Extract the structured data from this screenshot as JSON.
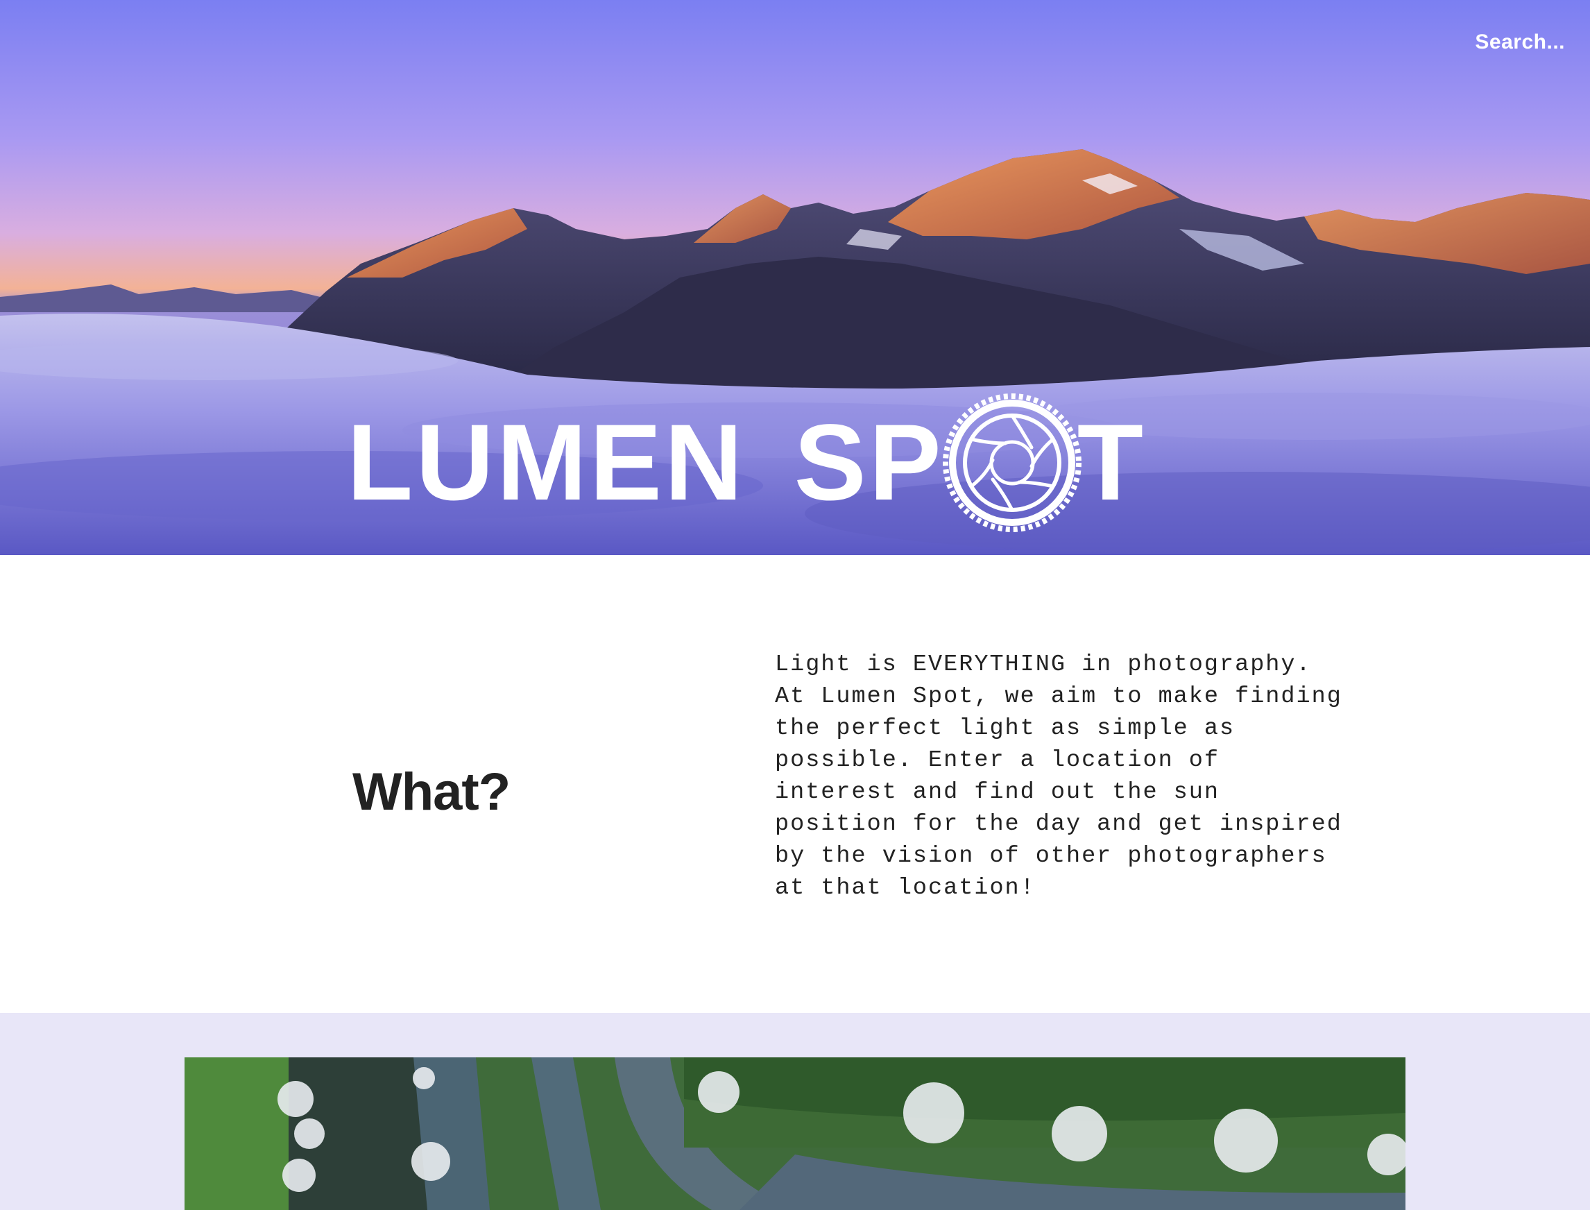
{
  "header": {
    "search_placeholder": "Search...",
    "logo_text_part1": "LUMEN",
    "logo_text_part2": "SP",
    "logo_text_part3": "T"
  },
  "what_section": {
    "title": "What?",
    "description": "Light is EVERYTHING in photography.\nAt Lumen Spot, we aim to make finding\nthe perfect light as simple as\npossible. Enter a location of\ninterest and find out the sun\nposition for the day and get inspired\nby the vision of other photographers\nat that location!"
  },
  "colors": {
    "accent": "#e8e6f8",
    "hero_sky": "#8b86e6",
    "text": "#222222"
  },
  "icons": {
    "logo_o": "camera-aperture-icon"
  }
}
